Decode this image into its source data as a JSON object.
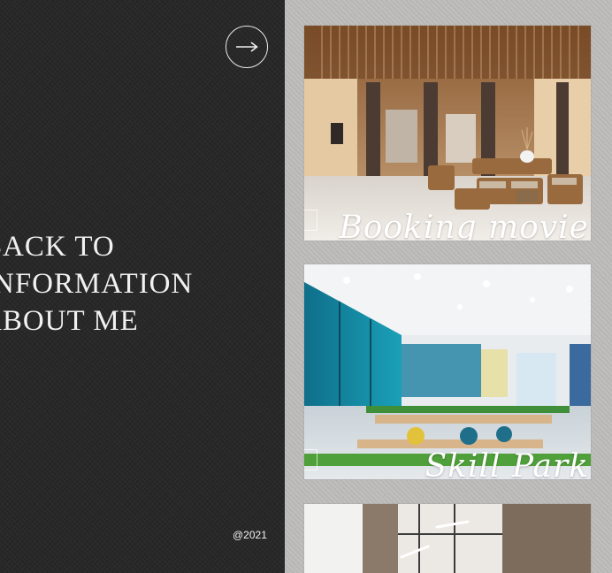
{
  "header": {
    "next_icon": "arrow-right-icon"
  },
  "intro": {
    "line1": "BACK TO",
    "line2": "INFORMATION",
    "line3": "ABOUT ME"
  },
  "footer": {
    "copyright": "@2021"
  },
  "projects": [
    {
      "caption": "Booking movie"
    },
    {
      "caption": "Skill Park"
    },
    {
      "caption": ""
    }
  ],
  "colors": {
    "left_background": "#262626",
    "right_background": "#bdbcba",
    "text": "#f1f1f1"
  }
}
